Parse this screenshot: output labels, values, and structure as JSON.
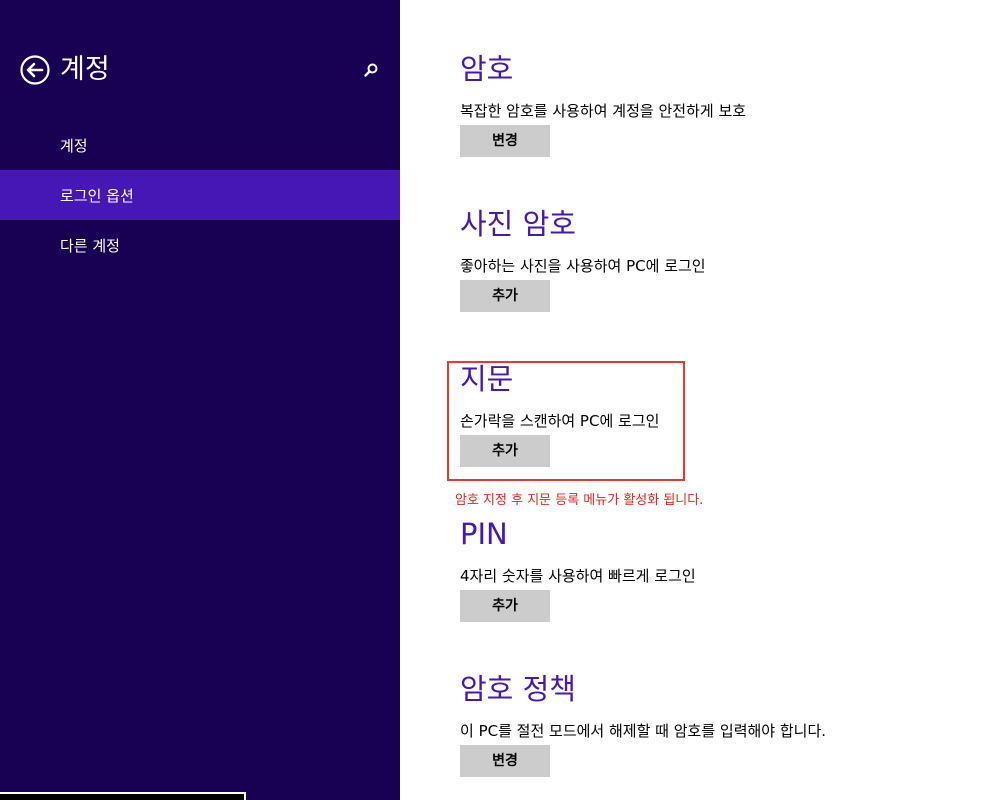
{
  "sidebar": {
    "title": "계정",
    "back_icon": "back-arrow-circle-icon",
    "search_icon": "search-icon",
    "items": [
      {
        "label": "계정",
        "active": false
      },
      {
        "label": "로그인 옵션",
        "active": true
      },
      {
        "label": "다른 계정",
        "active": false
      }
    ]
  },
  "main": {
    "sections": [
      {
        "title": "암호",
        "description": "복잡한 암호를 사용하여 계정을 안전하게 보호",
        "button": "변경"
      },
      {
        "title": "사진 암호",
        "description": "좋아하는 사진을 사용하여 PC에 로그인",
        "button": "추가"
      },
      {
        "title": "지문",
        "description": "손가락을 스캔하여 PC에 로그인",
        "button": "추가"
      },
      {
        "title": "PIN",
        "description": "4자리 숫자를 사용하여 빠르게 로그인",
        "button": "추가"
      },
      {
        "title": "암호 정책",
        "description": "이 PC를 절전 모드에서 해제할 때 암호를 입력해야 합니다.",
        "button": "변경"
      }
    ],
    "annotation": "암호 지정 후 지문 등록 메뉴가 활성화 됩니다."
  },
  "colors": {
    "sidebar_bg": "#180052",
    "active_item_bg": "#4617b4",
    "accent": "#4617b4",
    "button_bg": "#cccccc",
    "annotation": "#e3261a"
  }
}
